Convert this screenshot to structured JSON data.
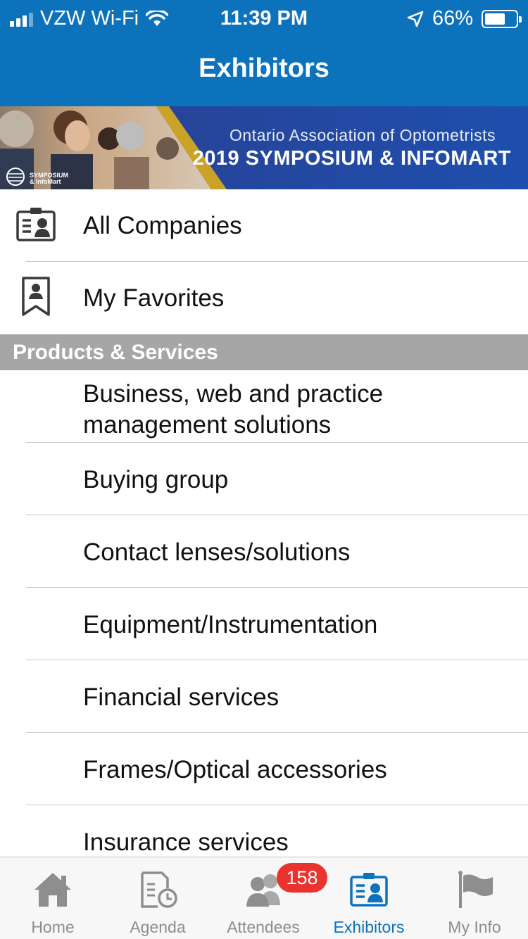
{
  "status_bar": {
    "carrier": "VZW Wi-Fi",
    "time": "11:39 PM",
    "battery_percent": "66%",
    "battery_level": 0.66
  },
  "nav": {
    "title": "Exhibitors"
  },
  "banner": {
    "org": "Ontario Association of Optometrists",
    "event": "2019 SYMPOSIUM & INFOMART",
    "logo_line1": "SYMPOSIUM",
    "logo_line2": "& InfoMart"
  },
  "menu": [
    {
      "label": "All Companies",
      "icon": "id-card-icon"
    },
    {
      "label": "My Favorites",
      "icon": "bookmark-person-icon"
    }
  ],
  "section": {
    "title": "Products & Services"
  },
  "categories": [
    "Business, web and practice management solutions",
    "Buying group",
    "Contact lenses/solutions",
    "Equipment/Instrumentation",
    "Financial services",
    "Frames/Optical accessories",
    "Insurance services"
  ],
  "tab_bar": {
    "tabs": [
      {
        "label": "Home",
        "icon": "home-icon"
      },
      {
        "label": "Agenda",
        "icon": "agenda-clock-icon"
      },
      {
        "label": "Attendees",
        "icon": "people-icon"
      },
      {
        "label": "Exhibitors",
        "icon": "id-card-icon"
      },
      {
        "label": "My Info",
        "icon": "flag-icon"
      }
    ],
    "active": "Exhibitors",
    "attendees_badge": "158"
  },
  "colors": {
    "header_blue": "#0c72bb",
    "section_gray": "#a6a6a6",
    "badge_red": "#e8332e",
    "inactive_tab": "#8e8e8e"
  }
}
